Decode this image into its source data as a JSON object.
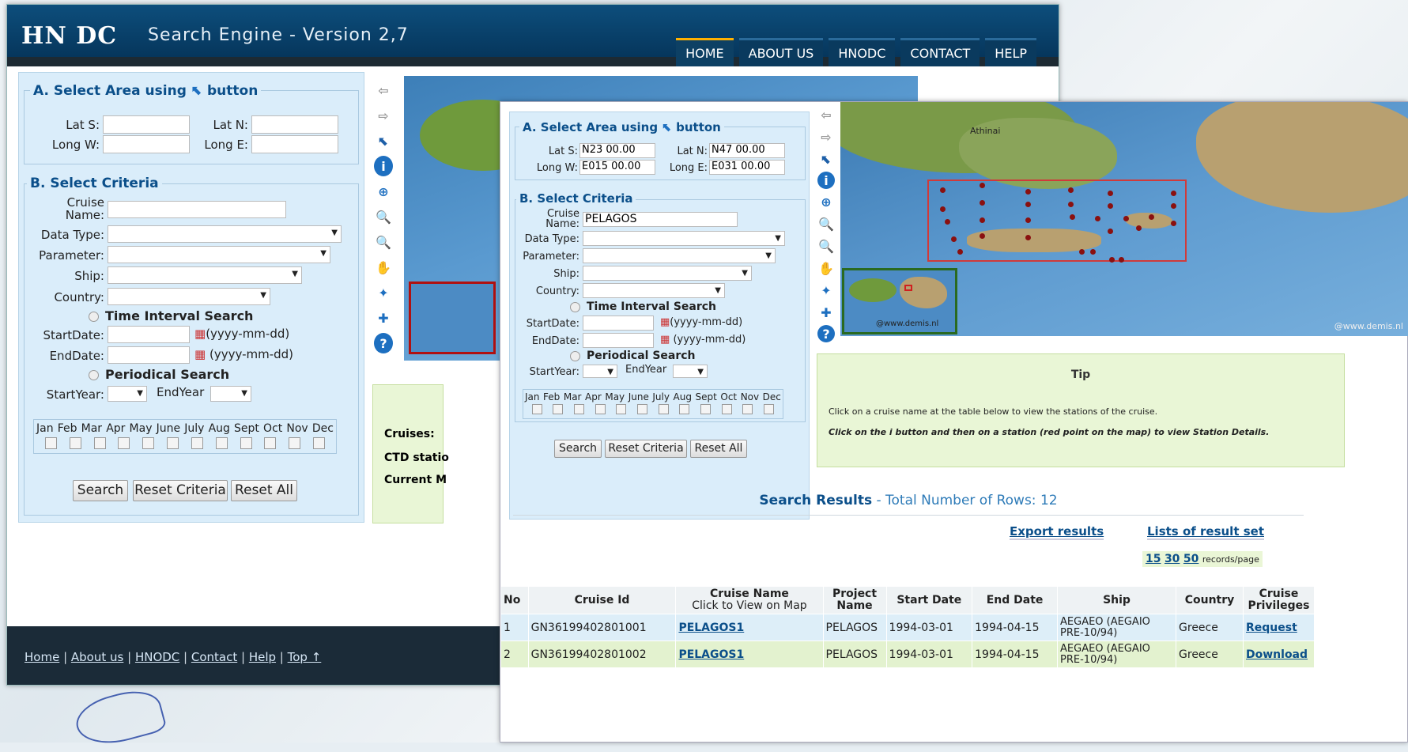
{
  "app": {
    "logo": "HN DC",
    "title": "Search Engine - Version 2,7"
  },
  "nav": [
    "HOME",
    "ABOUT US",
    "HNODC",
    "CONTACT",
    "HELP"
  ],
  "sectionA": {
    "title": "A. Select Area using",
    "title2": "button",
    "lat_s": "Lat S:",
    "lat_n": "Lat N:",
    "long_w": "Long W:",
    "long_e": "Long E:"
  },
  "sectionB": {
    "title": "B. Select Criteria",
    "cruise_name": "Cruise Name:",
    "data_type": "Data Type:",
    "parameter": "Parameter:",
    "ship": "Ship:",
    "country": "Country:",
    "time_interval": "Time Interval Search",
    "start_date": "StartDate:",
    "end_date": "EndDate:",
    "date_fmt": "(yyyy-mm-dd)",
    "periodical": "Periodical Search",
    "start_year": "StartYear:",
    "end_year": "EndYear"
  },
  "months": [
    "Jan",
    "Feb",
    "Mar",
    "Apr",
    "May",
    "June",
    "July",
    "Aug",
    "Sept",
    "Oct",
    "Nov",
    "Dec"
  ],
  "buttons": {
    "search": "Search",
    "reset_criteria": "Reset Criteria",
    "reset_all": "Reset All"
  },
  "left_info": {
    "cruises": "Cruises:",
    "ctd": "CTD statio",
    "current": "Current M"
  },
  "footer": {
    "home": "Home",
    "about": "About us",
    "hnodc": "HNODC",
    "contact": "Contact",
    "help": "Help",
    "top": "Top ↑"
  },
  "front": {
    "values": {
      "lat_s": "N23 00.00",
      "lat_n": "N47 00.00",
      "long_w": "E015 00.00",
      "long_e": "E031 00.00",
      "cruise_name": "PELAGOS"
    },
    "map": {
      "city": "Athinai",
      "credit": "@www.demis.nl",
      "credit_small": "@www.demis.nl"
    },
    "tip": {
      "title": "Tip",
      "line1": "Click on a cruise name at the table below to view the stations of the cruise.",
      "line2": "Click on the i button and then on a station (red point on the map) to view Station Details."
    },
    "results": {
      "title": "Search Results",
      "total": "- Total Number of Rows: 12",
      "export": "Export results",
      "lists": "Lists of result set",
      "pages": [
        "15",
        "30",
        "50"
      ],
      "per_page": "records/page"
    },
    "table": {
      "headers": [
        "No",
        "Cruise Id",
        "Cruise Name",
        "Click to View on Map",
        "Project Name",
        "Start Date",
        "End Date",
        "Ship",
        "Country",
        "Cruise Privileges"
      ],
      "rows": [
        {
          "no": "1",
          "id": "GN36199402801001",
          "name": "PELAGOS1",
          "project": "PELAGOS",
          "start": "1994-03-01",
          "end": "1994-04-15",
          "ship": "AEGAEO (AEGAIO PRE-10/94)",
          "country": "Greece",
          "priv": "Request"
        },
        {
          "no": "2",
          "id": "GN36199402801002",
          "name": "PELAGOS1",
          "project": "PELAGOS",
          "start": "1994-03-01",
          "end": "1994-04-15",
          "ship": "AEGAEO (AEGAIO PRE-10/94)",
          "country": "Greece",
          "priv": "Download"
        }
      ]
    }
  }
}
